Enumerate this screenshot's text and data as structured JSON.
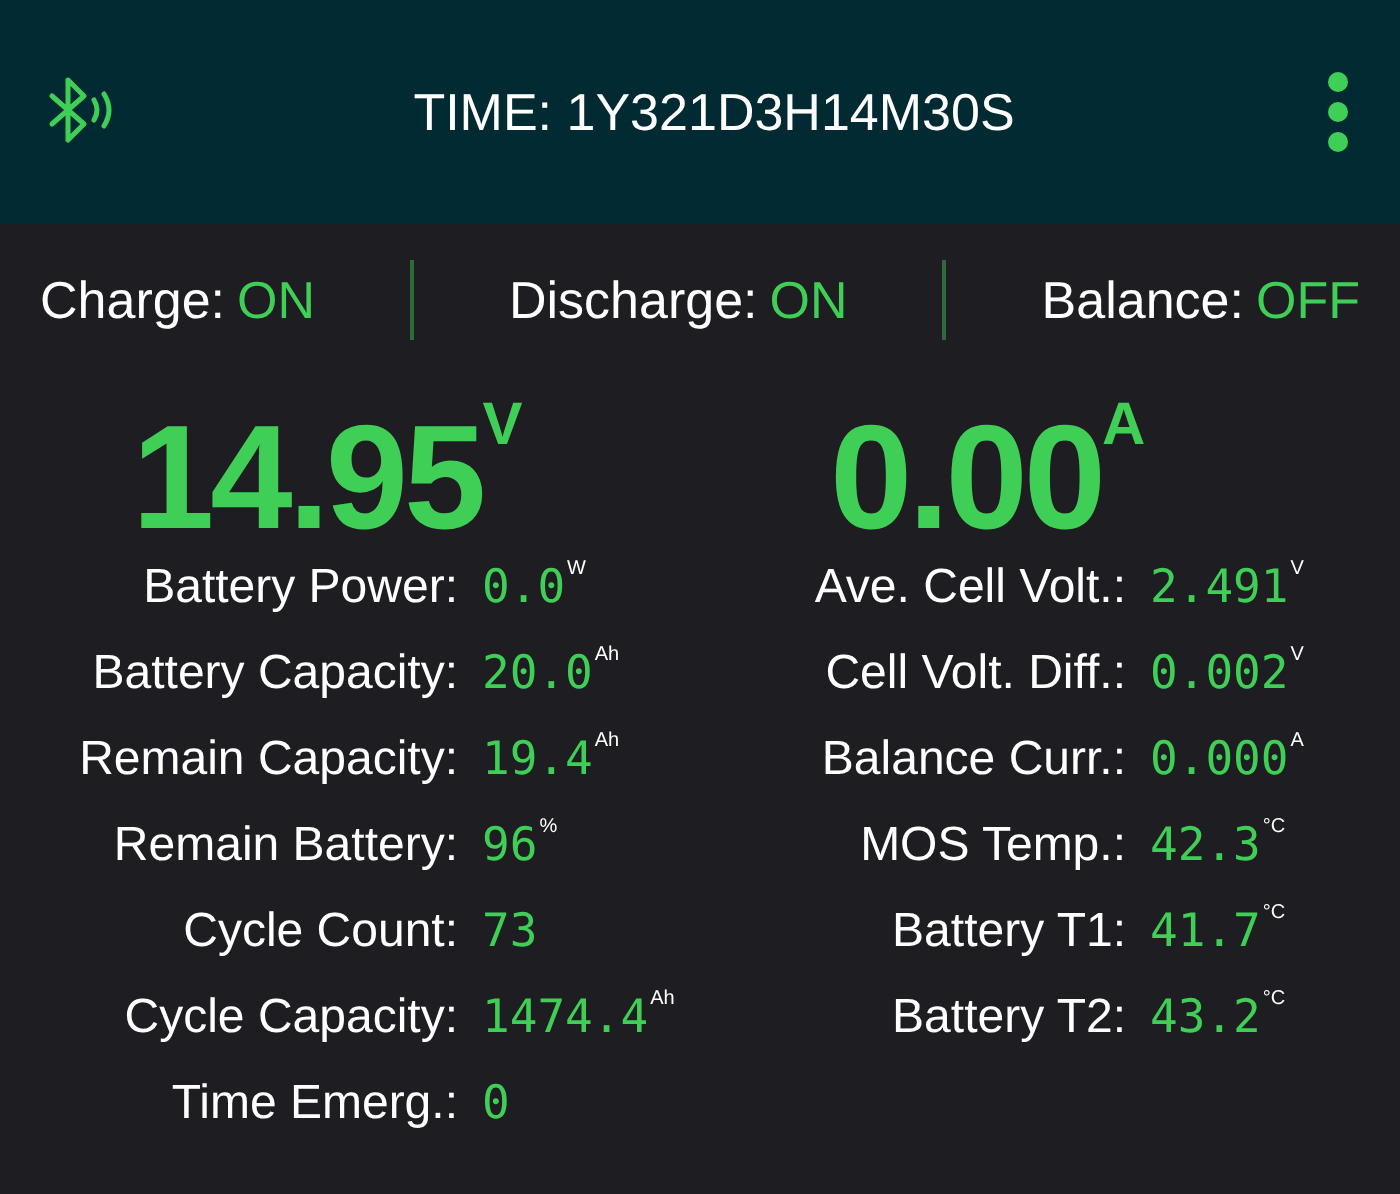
{
  "header": {
    "title": "TIME: 1Y321D3H14M30S"
  },
  "status": [
    {
      "label": "Charge:",
      "value": "ON"
    },
    {
      "label": "Discharge:",
      "value": "ON"
    },
    {
      "label": "Balance:",
      "value": "OFF"
    }
  ],
  "readouts": [
    {
      "value": "14.95",
      "unit": "V"
    },
    {
      "value": "0.00",
      "unit": "A"
    }
  ],
  "columns": [
    [
      {
        "label": "Battery Power:",
        "value": "0.0",
        "unit": "W"
      },
      {
        "label": "Battery Capacity:",
        "value": "20.0",
        "unit": "Ah"
      },
      {
        "label": "Remain Capacity:",
        "value": "19.4",
        "unit": "Ah"
      },
      {
        "label": "Remain Battery:",
        "value": "96",
        "unit": "%"
      },
      {
        "label": "Cycle Count:",
        "value": "73"
      },
      {
        "label": "Cycle Capacity:",
        "value": "1474.4",
        "unit": "Ah"
      },
      {
        "label": "Time Emerg.:",
        "value": "0"
      }
    ],
    [
      {
        "label": "Ave. Cell Volt.:",
        "value": "2.491",
        "unit": "V"
      },
      {
        "label": "Cell Volt. Diff.:",
        "value": "0.002",
        "unit": "V"
      },
      {
        "label": "Balance Curr.:",
        "value": "0.000",
        "unit": "A"
      },
      {
        "label": "MOS Temp.:",
        "value": "42.3",
        "unit": "°C"
      },
      {
        "label": "Battery T1:",
        "value": "41.7",
        "unit": "°C"
      },
      {
        "label": "Battery T2:",
        "value": "43.2",
        "unit": "°C"
      }
    ]
  ]
}
